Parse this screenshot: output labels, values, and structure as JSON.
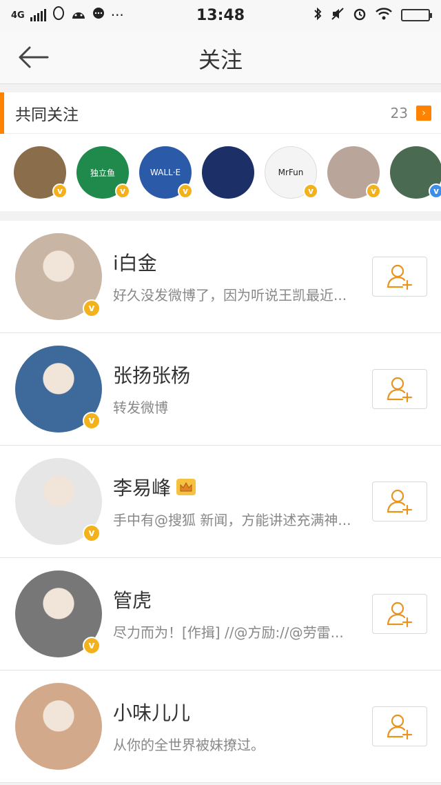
{
  "status_bar": {
    "network": "4G",
    "time": "13:48",
    "dots": "···"
  },
  "nav": {
    "title": "关注"
  },
  "mutual": {
    "title": "共同关注",
    "count": "23",
    "arrow": "›",
    "avatars": [
      {
        "name": "mutual-avatar-1",
        "badge": "gold",
        "color": "#8a6d4a"
      },
      {
        "name": "mutual-avatar-2",
        "badge": "gold",
        "color": "#1f8a4c",
        "text": "独立鱼"
      },
      {
        "name": "mutual-avatar-3",
        "badge": "gold",
        "color": "#2b5aa8",
        "text": "WALL·E"
      },
      {
        "name": "mutual-avatar-4",
        "badge": "none",
        "color": "#1c2f66"
      },
      {
        "name": "mutual-avatar-5",
        "badge": "gold",
        "color": "#f4f4f4",
        "text": "MrFun"
      },
      {
        "name": "mutual-avatar-6",
        "badge": "gold",
        "color": "#b9a59a"
      },
      {
        "name": "mutual-avatar-7",
        "badge": "blue",
        "color": "#4a6a52"
      }
    ]
  },
  "users": [
    {
      "name": "i白金",
      "desc": "好久没发微博了，因为听说王凯最近...",
      "crown": false,
      "color": "#c9b5a4"
    },
    {
      "name": "张扬张杨",
      "desc": "转发微博",
      "crown": false,
      "color": "#3d6a9a"
    },
    {
      "name": "李易峰",
      "desc": "手中有@搜狐 新闻，方能讲述充满神...",
      "crown": true,
      "color": "#e6e6e6"
    },
    {
      "name": "管虎",
      "desc": "尽力而为！[作揖] //@方励://@劳雷...",
      "crown": false,
      "color": "#777777"
    },
    {
      "name": "小味儿儿",
      "desc": "从你的全世界被妹撩过。",
      "crown": false,
      "color": "#d2a98a"
    }
  ],
  "colors": {
    "accent": "#ff8200",
    "verified_gold": "#f3b21b",
    "verified_blue": "#3d8ee8"
  },
  "icons": {
    "back": "back-arrow-icon",
    "follow": "add-user-icon",
    "badge": "v"
  }
}
